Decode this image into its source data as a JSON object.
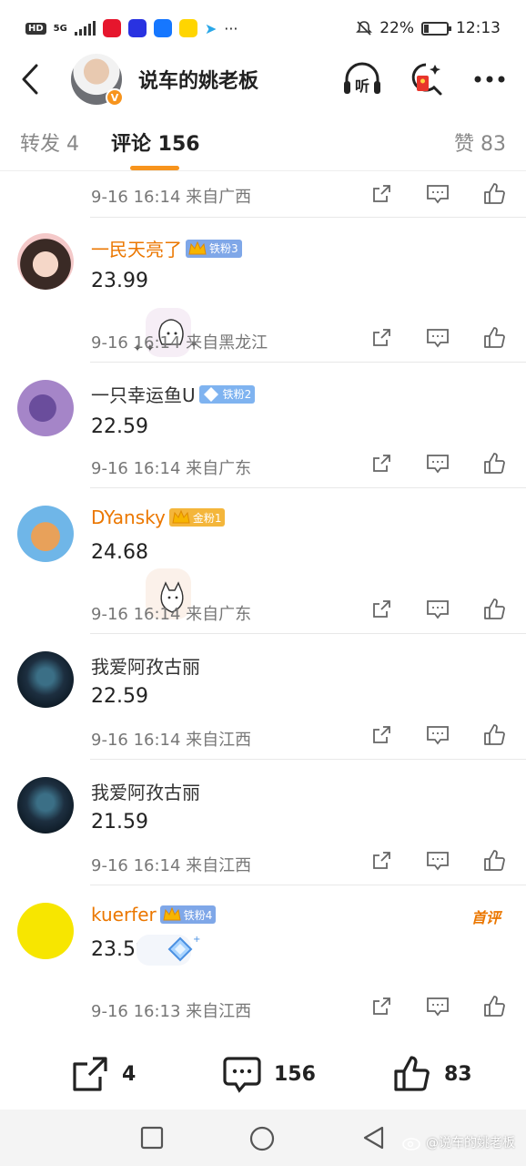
{
  "status_bar": {
    "hd": "HD",
    "network": "5G",
    "battery_percent": "22%",
    "battery_level": 0.22,
    "time": "12:13"
  },
  "header": {
    "title": "说车的姚老板",
    "verified_badge": "V",
    "listen_label": "听",
    "icons": [
      "back-arrow-icon",
      "listen-headphones-icon",
      "red-packet-search-icon",
      "more-dots-icon"
    ]
  },
  "tabs": [
    {
      "label": "转发 4",
      "active": false
    },
    {
      "label": "评论 156",
      "active": true
    },
    {
      "label": "赞 83",
      "active": false
    }
  ],
  "top_meta": "9-16 16:14  来自广西",
  "comments": [
    {
      "name": "一民天亮了",
      "name_color": "orange",
      "badge": "铁粉3",
      "badge_color": "#7fa7e8",
      "text": "23.99",
      "sticker": "cat",
      "meta": "9-16 16:14  来自黑龙江"
    },
    {
      "name": "一只幸运鱼U",
      "name_color": "plain",
      "badge": "铁粉2",
      "badge_color": "#7fb3f0",
      "text": "22.59",
      "sticker": "",
      "meta": "9-16 16:14  来自广东"
    },
    {
      "name": "DYansky",
      "name_color": "orange",
      "badge": "金粉1",
      "badge_color": "#f4b63b",
      "text": "24.68",
      "sticker": "husky",
      "meta": "9-16 16:14  来自广东"
    },
    {
      "name": "我爱阿孜古丽",
      "name_color": "plain",
      "badge": "",
      "text": "22.59",
      "sticker": "",
      "meta": "9-16 16:14  来自江西"
    },
    {
      "name": "我爱阿孜古丽",
      "name_color": "plain",
      "badge": "",
      "text": "21.59",
      "sticker": "",
      "meta": "9-16 16:14  来自江西"
    },
    {
      "name": "kuerfer",
      "name_color": "orange",
      "badge": "铁粉4",
      "badge_color": "#7fa7e8",
      "text": "23.59",
      "sticker": "diamond",
      "meta": "9-16 16:13  来自江西",
      "tag": "首评"
    }
  ],
  "bottom_bar": {
    "repost_count": "4",
    "comment_count": "156",
    "like_count": "83"
  },
  "watermark": "@说车的姚老板",
  "colors": {
    "accent": "#f7941d",
    "name_orange": "#eb7700",
    "meta_gray": "#777777"
  }
}
